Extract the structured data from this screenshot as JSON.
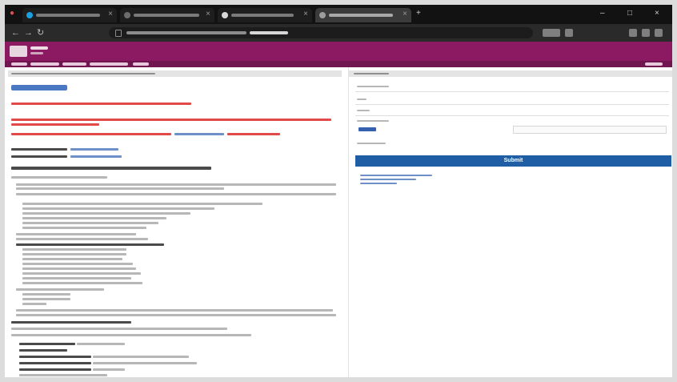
{
  "colors": {
    "brand": "#8b1a63",
    "brand_dark": "#701550",
    "primary_button": "#1f5ea5",
    "alert_text": "#e24a4a",
    "link_text": "#6f8fc9",
    "browser_chrome": "#121212"
  },
  "icons": {
    "browser_close": "close-icon",
    "back": "back-arrow-icon",
    "forward": "forward-arrow-icon",
    "reload": "reload-icon",
    "lock": "lock-icon",
    "new_tab": "plus-icon"
  },
  "right_panel": {
    "submit_label": "Submit"
  }
}
